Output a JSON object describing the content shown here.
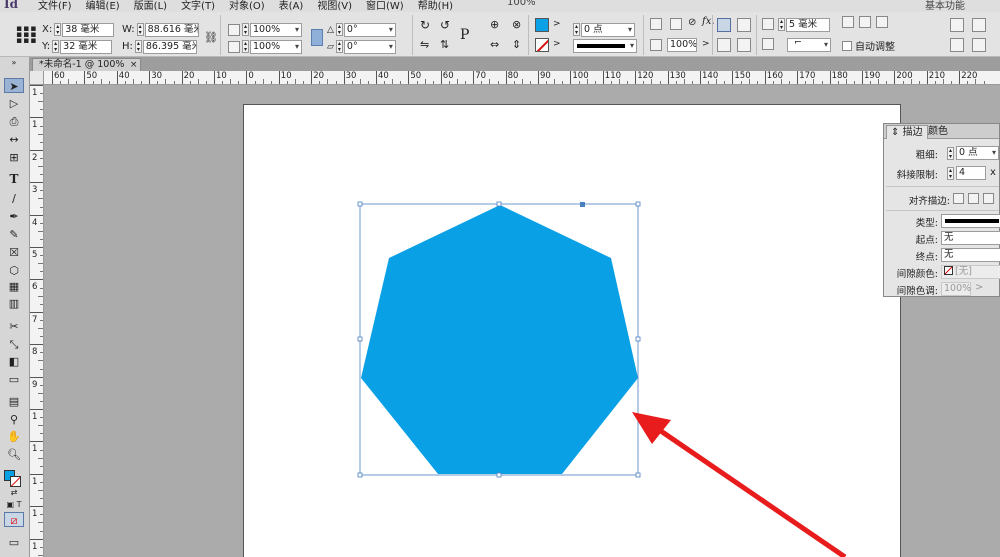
{
  "app": {
    "logo": "Id",
    "workspace": "基本功能",
    "zoom": "100%"
  },
  "menu": [
    "文件(F)",
    "编辑(E)",
    "版面(L)",
    "文字(T)",
    "对象(O)",
    "表(A)",
    "视图(V)",
    "窗口(W)",
    "帮助(H)"
  ],
  "control": {
    "x_label": "X:",
    "x_value": "38 毫米",
    "y_label": "Y:",
    "y_value": "32 毫米",
    "w_label": "W:",
    "w_value": "88.616 毫米",
    "h_label": "H:",
    "h_value": "86.395 毫米",
    "scale_x": "100%",
    "scale_y": "100%",
    "rotate": "0°",
    "shear": "0°",
    "stroke_weight": "0 点",
    "opacity": "100%",
    "spacing": "5 毫米",
    "auto_fit": "自动调整"
  },
  "tab": {
    "title": "*未命名-1 @ 100%",
    "close": "×"
  },
  "ruler_h": [
    "60",
    "50",
    "40",
    "30",
    "20",
    "10",
    "0",
    "10",
    "20",
    "30",
    "40",
    "50",
    "60",
    "70",
    "80",
    "90",
    "100",
    "110",
    "120",
    "130",
    "140",
    "150",
    "160",
    "170",
    "180",
    "190",
    "200",
    "210",
    "220"
  ],
  "ruler_v": [
    "1",
    "1",
    "2",
    "3",
    "4",
    "5",
    "6",
    "7",
    "8",
    "9",
    "1",
    "1",
    "1",
    "1",
    "1"
  ],
  "stroke_panel": {
    "tab_stroke": "描边",
    "tab_color": "颜色",
    "weight_label": "粗细:",
    "weight_value": "0 点",
    "miter_label": "斜接限制:",
    "miter_value": "4",
    "miter_unit": "x",
    "align_label": "对齐描边:",
    "type_label": "类型:",
    "start_label": "起点:",
    "start_value": "无",
    "end_label": "终点:",
    "end_value": "无",
    "gap_color_label": "间隙颜色:",
    "gap_color_value": "[无]",
    "gap_tint_label": "间隙色调:",
    "gap_tint_value": "100%"
  },
  "colors": {
    "shape_fill": "#0aa0e6",
    "arrow": "#e81c1c",
    "selection": "#4a7fc1"
  }
}
